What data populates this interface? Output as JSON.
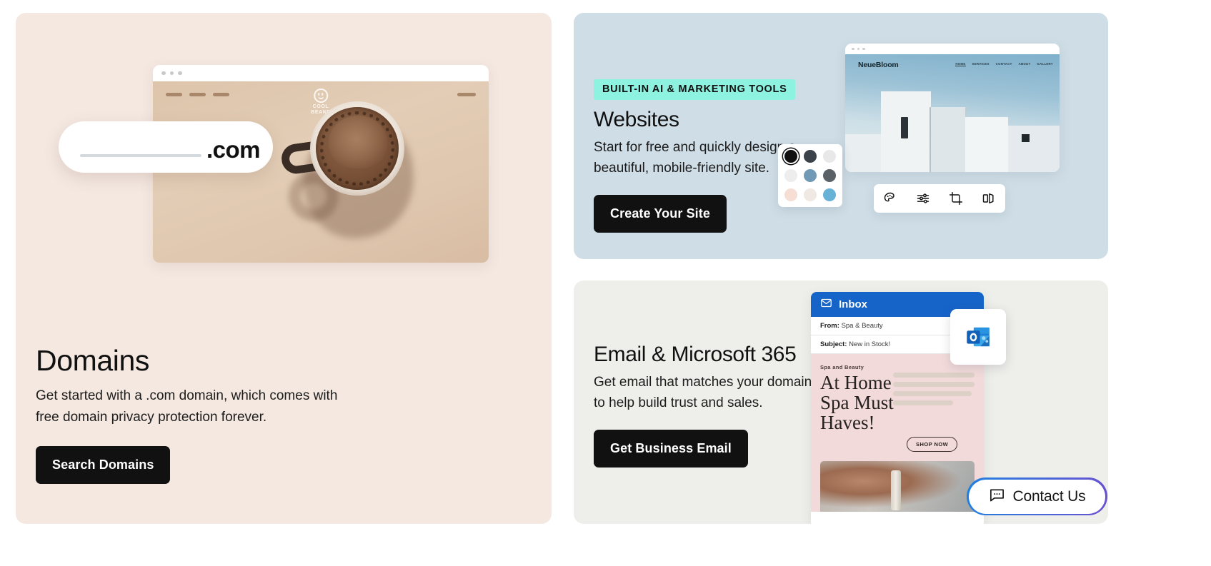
{
  "theme": {
    "page_bg": "#ffffff",
    "domains_card_bg": "#f4e8e1",
    "websites_card_bg": "#cfdde6",
    "email_card_bg": "#eeeeea",
    "cta_bg": "#111111",
    "cta_text": "#ffffff",
    "badge_bg": "#8df2e0",
    "inbox_blue": "#1664c8",
    "contact_gradient_from": "#1f7fe0",
    "contact_gradient_to": "#6a4fd0"
  },
  "cards": {
    "domains": {
      "title": "Domains",
      "description": "Get started with a .com domain, which comes with free domain privacy protection forever.",
      "cta_label": "Search Domains",
      "illustration": {
        "search_pill_tld": ".com",
        "search_pill_placeholder": "",
        "browser_site_logo_line1": "COOL",
        "browser_site_logo_line2": "BEANS",
        "browser_dots": 3,
        "nav_dashes": 3
      }
    },
    "websites": {
      "badge": "BUILT-IN AI & MARKETING TOOLS",
      "title": "Websites",
      "description": "Start for free and quickly design a beautiful, mobile-friendly site.",
      "cta_label": "Create Your Site",
      "illustration": {
        "site_brand": "NeueBloom",
        "site_nav": [
          "HOME",
          "SERVICES",
          "CONTACT",
          "ABOUT",
          "GALLERY"
        ],
        "site_nav_active": "HOME",
        "browser_dots": 3,
        "swatches": [
          {
            "color": "#111111",
            "selected": true
          },
          {
            "color": "#3b4249",
            "selected": false
          },
          {
            "color": "#e8e8e8",
            "selected": false
          },
          {
            "color": "#ededed",
            "selected": false
          },
          {
            "color": "#6f99b4",
            "selected": false
          },
          {
            "color": "#5a6268",
            "selected": false
          },
          {
            "color": "#f6ded4",
            "selected": false
          },
          {
            "color": "#f0e8e2",
            "selected": false
          },
          {
            "color": "#68b2d8",
            "selected": false
          }
        ],
        "toolbar_icons": [
          "palette-icon",
          "sliders-icon",
          "crop-icon",
          "pages-icon"
        ]
      }
    },
    "email": {
      "title": "Email & Microsoft 365",
      "description": "Get email that matches your domain to help build trust and sales.",
      "cta_label": "Get Business Email",
      "illustration": {
        "inbox_label": "Inbox",
        "from_label": "From:",
        "from_value": "Spa & Beauty",
        "subject_label": "Subject:",
        "subject_value": "New in Stock!",
        "promo_eyebrow": "Spa and Beauty",
        "promo_headline_line1": "At Home",
        "promo_headline_line2": "Spa Must",
        "promo_headline_line3": "Haves!",
        "promo_cta": "SHOP NOW",
        "promo_text_line_widths": [
          114,
          114,
          110,
          84
        ],
        "app_badge": "outlook-icon"
      }
    }
  },
  "contact_widget": {
    "label": "Contact Us",
    "icon": "chat-bubble-icon"
  }
}
